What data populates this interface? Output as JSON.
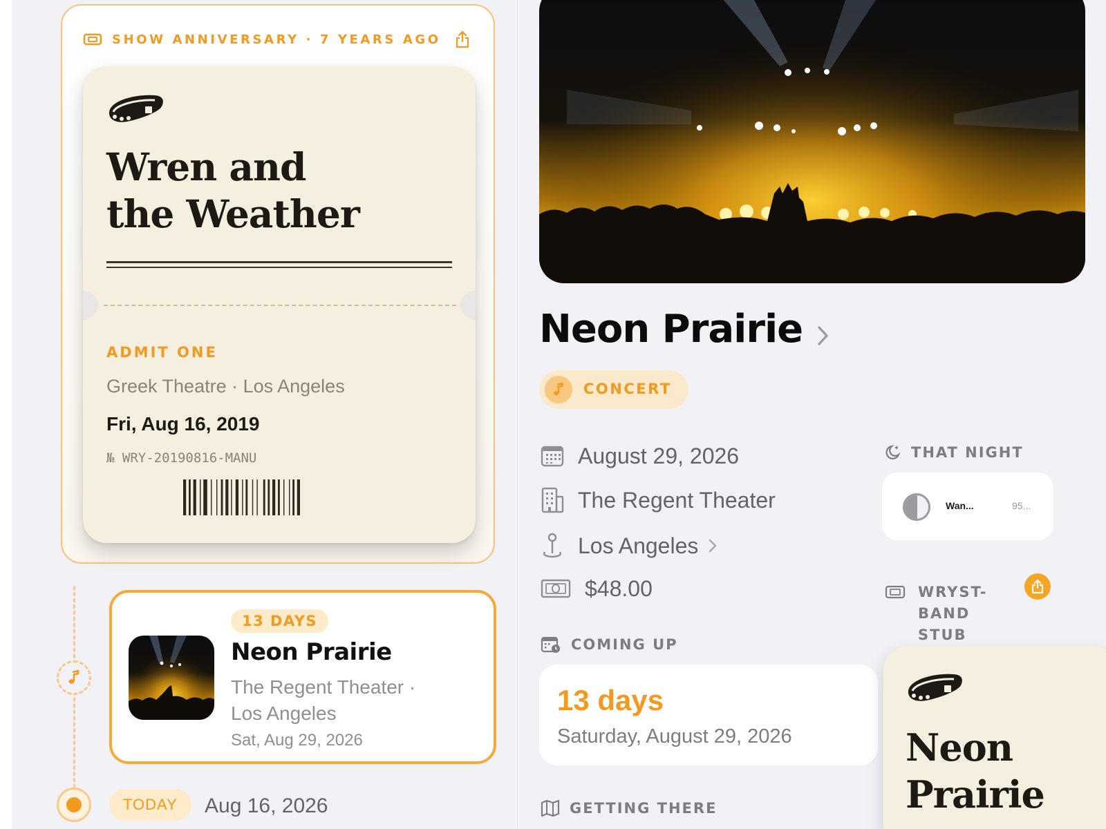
{
  "anniversary": {
    "header": "SHOW ANNIVERSARY · 7 YEARS AGO",
    "ticket": {
      "title_line1": "Wren and",
      "title_line2": "the Weather",
      "admit": "ADMIT ONE",
      "venue": "Greek Theatre · Los Angeles",
      "date": "Fri, Aug 16, 2019",
      "serial": "№ WRY-20190816-MANU"
    }
  },
  "timeline": {
    "upcoming": {
      "badge": "13 DAYS",
      "title": "Neon Prairie",
      "venue": "The Regent Theater · Los Angeles",
      "date": "Sat, Aug 29, 2026"
    },
    "today_label": "TODAY",
    "today_date": "Aug 16, 2026"
  },
  "event": {
    "title": "Neon Prairie",
    "category": "CONCERT",
    "date": "August 29, 2026",
    "venue": "The Regent Theater",
    "city": "Los Angeles",
    "price": "$48.00"
  },
  "coming_up": {
    "header": "COMING UP",
    "days": "13 days",
    "full_date": "Saturday, August 29, 2026"
  },
  "getting_there": {
    "header": "GETTING THERE"
  },
  "that_night": {
    "header": "THAT NIGHT",
    "moon_phase": "Wan...",
    "moon_value": "95..."
  },
  "stub": {
    "header_line1": "WRYST-",
    "header_line2": "BAND",
    "header_line3": "STUB",
    "title_line1": "Neon",
    "title_line2": "Prairie"
  },
  "colors": {
    "accent": "#f29a1f",
    "ticket_paper": "#f5efdf",
    "pill": "#fbe9cb"
  }
}
